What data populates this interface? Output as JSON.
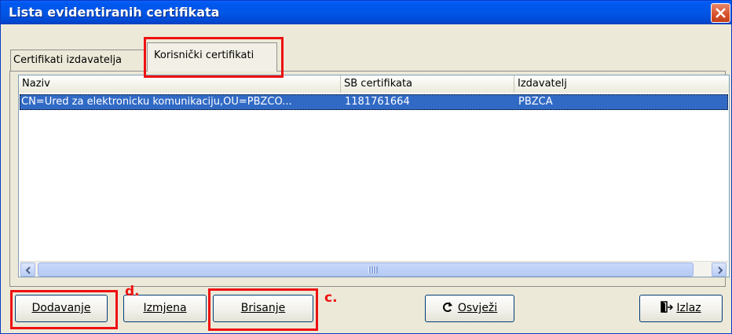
{
  "window": {
    "title": "Lista evidentiranih certifikata"
  },
  "tabs": [
    {
      "label": "Certifikati izdavatelja"
    },
    {
      "label": "Korisnički certifikati"
    }
  ],
  "list": {
    "columns": [
      "Naziv",
      "SB certifikata",
      "Izdavatelj"
    ],
    "rows": [
      {
        "naziv": "CN=Ured za elektronicku komunikaciju,OU=PBZCO...",
        "sb": "1181761664",
        "izdavatelj": "PBZCA"
      }
    ]
  },
  "buttons": {
    "dodavanje": "Dodavanje",
    "izmjena": "Izmjena",
    "brisanje": "Brisanje",
    "osvjezi": "Osvježi",
    "izlaz": "Izlaz"
  },
  "annotations": {
    "d": "d.",
    "c": "c."
  },
  "icons": {
    "close": "close-icon",
    "refresh": "refresh-icon",
    "exit": "exit-door-icon"
  },
  "colors": {
    "title_bar": "#0055e5",
    "selection": "#316ac5",
    "annotation": "#ee1111"
  }
}
